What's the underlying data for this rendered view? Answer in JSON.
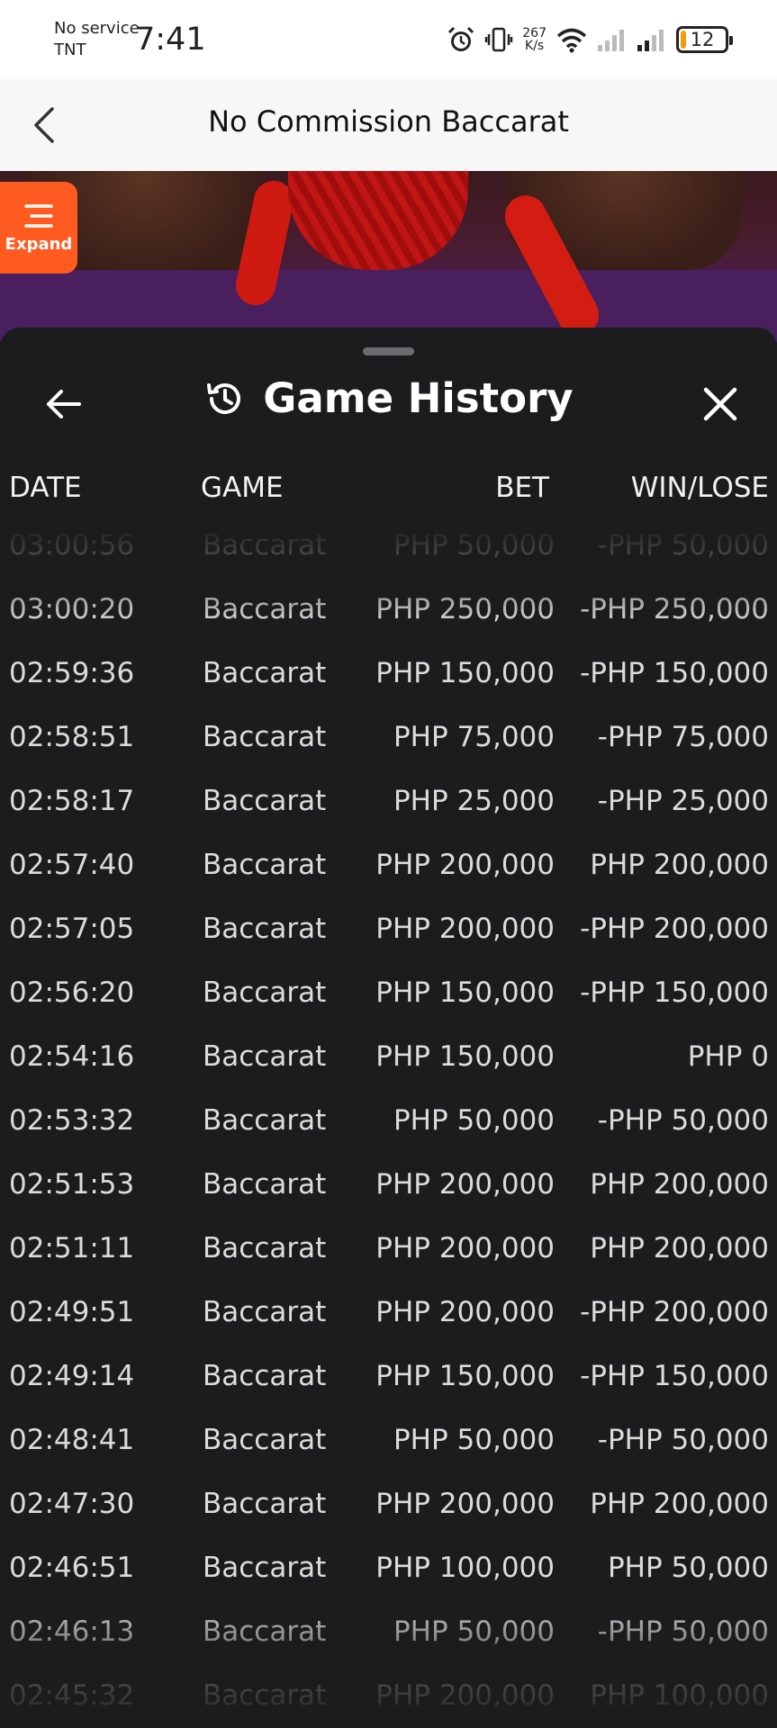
{
  "status_bar": {
    "carrier_line1": "No service",
    "carrier_line2": "TNT",
    "time": "7:41",
    "net_speed_value": "267",
    "net_speed_unit": "K/s",
    "battery_level": "12",
    "icons": [
      "alarm-icon",
      "vibrate-icon",
      "wifi-icon",
      "signal-icon",
      "signal-icon",
      "battery-icon"
    ]
  },
  "header": {
    "title": "No Commission Baccarat",
    "back_icon": "chevron-left-icon"
  },
  "expand_button": {
    "label": "Expand",
    "icon": "menu-icon",
    "color": "#ff5a1f"
  },
  "history": {
    "title": "Game History",
    "back_icon": "arrow-left-icon",
    "title_icon": "history-icon",
    "close_icon": "close-icon",
    "columns": {
      "date": "DATE",
      "game": "GAME",
      "bet": "BET",
      "win": "WIN/LOSE"
    },
    "rows": [
      {
        "date": "03:00:56",
        "game": "Baccarat",
        "bet": "PHP 50,000",
        "win": "-PHP 50,000"
      },
      {
        "date": "03:00:20",
        "game": "Baccarat",
        "bet": "PHP 250,000",
        "win": "-PHP 250,000"
      },
      {
        "date": "02:59:36",
        "game": "Baccarat",
        "bet": "PHP 150,000",
        "win": "-PHP 150,000"
      },
      {
        "date": "02:58:51",
        "game": "Baccarat",
        "bet": "PHP 75,000",
        "win": "-PHP 75,000"
      },
      {
        "date": "02:58:17",
        "game": "Baccarat",
        "bet": "PHP 25,000",
        "win": "-PHP 25,000"
      },
      {
        "date": "02:57:40",
        "game": "Baccarat",
        "bet": "PHP 200,000",
        "win": "PHP 200,000"
      },
      {
        "date": "02:57:05",
        "game": "Baccarat",
        "bet": "PHP 200,000",
        "win": "-PHP 200,000"
      },
      {
        "date": "02:56:20",
        "game": "Baccarat",
        "bet": "PHP 150,000",
        "win": "-PHP 150,000"
      },
      {
        "date": "02:54:16",
        "game": "Baccarat",
        "bet": "PHP 150,000",
        "win": "PHP 0"
      },
      {
        "date": "02:53:32",
        "game": "Baccarat",
        "bet": "PHP 50,000",
        "win": "-PHP 50,000"
      },
      {
        "date": "02:51:53",
        "game": "Baccarat",
        "bet": "PHP 200,000",
        "win": "PHP 200,000"
      },
      {
        "date": "02:51:11",
        "game": "Baccarat",
        "bet": "PHP 200,000",
        "win": "PHP 200,000"
      },
      {
        "date": "02:49:51",
        "game": "Baccarat",
        "bet": "PHP 200,000",
        "win": "-PHP 200,000"
      },
      {
        "date": "02:49:14",
        "game": "Baccarat",
        "bet": "PHP 150,000",
        "win": "-PHP 150,000"
      },
      {
        "date": "02:48:41",
        "game": "Baccarat",
        "bet": "PHP 50,000",
        "win": "-PHP 50,000"
      },
      {
        "date": "02:47:30",
        "game": "Baccarat",
        "bet": "PHP 200,000",
        "win": "PHP 200,000"
      },
      {
        "date": "02:46:51",
        "game": "Baccarat",
        "bet": "PHP 100,000",
        "win": "PHP 50,000"
      },
      {
        "date": "02:46:13",
        "game": "Baccarat",
        "bet": "PHP 50,000",
        "win": "-PHP 50,000"
      },
      {
        "date": "02:45:32",
        "game": "Baccarat",
        "bet": "PHP 200,000",
        "win": "PHP 100,000"
      }
    ]
  }
}
